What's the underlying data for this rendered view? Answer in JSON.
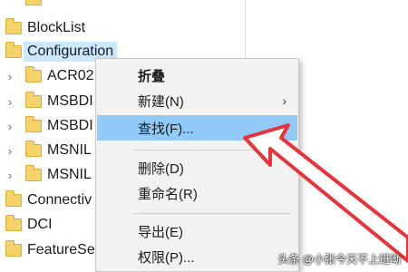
{
  "tree": {
    "items": [
      {
        "label": "BlockList",
        "chevron": false
      },
      {
        "label": "Configuration",
        "chevron": false,
        "selected": true
      },
      {
        "label": "ACR02",
        "chevron": true
      },
      {
        "label": "MSBDI",
        "chevron": true
      },
      {
        "label": "MSBDI",
        "chevron": true
      },
      {
        "label": "MSNIL",
        "chevron": true
      },
      {
        "label": "MSNIL",
        "chevron": true
      },
      {
        "label": "Connectiv",
        "chevron": false
      },
      {
        "label": "DCI",
        "chevron": false
      },
      {
        "label": "FeatureSe",
        "chevron": false
      }
    ]
  },
  "context_menu": {
    "items": [
      {
        "label": "折叠",
        "bold": true
      },
      {
        "label": "新建(N)",
        "submenu_arrow": "›"
      },
      {
        "label": "查找(F)...",
        "highlighted": true
      },
      {
        "label": "删除(D)"
      },
      {
        "label": "重命名(R)"
      },
      {
        "label": "导出(E)"
      },
      {
        "label": "权限(P)..."
      }
    ]
  },
  "watermark": "头条 @小张今天不上班呦",
  "colors": {
    "highlight": "#91c9f7",
    "annotation_arrow": "#e8333a",
    "folder": "#f6d26b"
  }
}
